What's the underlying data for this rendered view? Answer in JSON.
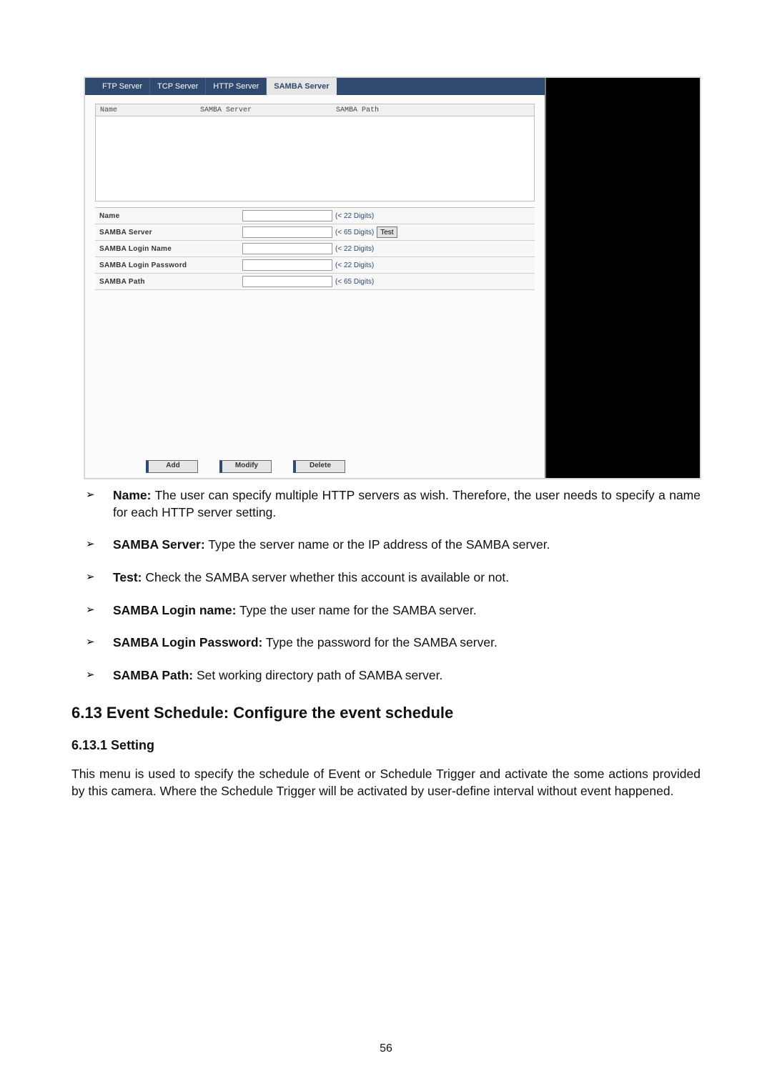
{
  "tabs": {
    "ftp": "FTP Server",
    "tcp": "TCP Server",
    "http": "HTTP Server",
    "samba": "SAMBA Server"
  },
  "listHeaders": {
    "name": "Name",
    "server": "SAMBA Server",
    "path": "SAMBA Path"
  },
  "formRows": {
    "name": {
      "label": "Name",
      "hint": "(< 22 Digits)"
    },
    "server": {
      "label": "SAMBA Server",
      "hint": "(< 65 Digits)"
    },
    "login": {
      "label": "SAMBA Login Name",
      "hint": "(< 22 Digits)"
    },
    "password": {
      "label": "SAMBA Login Password",
      "hint": "(< 22 Digits)"
    },
    "path": {
      "label": "SAMBA Path",
      "hint": "(< 65 Digits)"
    }
  },
  "testButton": "Test",
  "actionButtons": {
    "add": "Add",
    "modify": "Modify",
    "delete": "Delete"
  },
  "bullets": {
    "b1": {
      "bold": "Name:",
      "text": " The user can specify multiple HTTP servers as wish. Therefore, the user needs to specify a name for each HTTP server setting."
    },
    "b2": {
      "bold": "SAMBA Server:",
      "text": " Type the server name or the IP address of the SAMBA server."
    },
    "b3": {
      "bold": "Test:",
      "text": " Check the SAMBA server whether this account is available or not."
    },
    "b4": {
      "bold": "SAMBA Login name:",
      "text": " Type the user name for the SAMBA server."
    },
    "b5": {
      "bold": "SAMBA Login Password:",
      "text": " Type the password for the SAMBA server."
    },
    "b6": {
      "bold": "SAMBA Path:",
      "text": " Set working directory path of SAMBA server."
    }
  },
  "section": "6.13 Event Schedule: Configure the event schedule",
  "subsection": "6.13.1 Setting",
  "paragraph": "This menu is used to specify the schedule of Event or Schedule Trigger and activate the some actions provided by this camera. Where the Schedule Trigger will be activated by user-define interval without event happened.",
  "pageNumber": "56"
}
